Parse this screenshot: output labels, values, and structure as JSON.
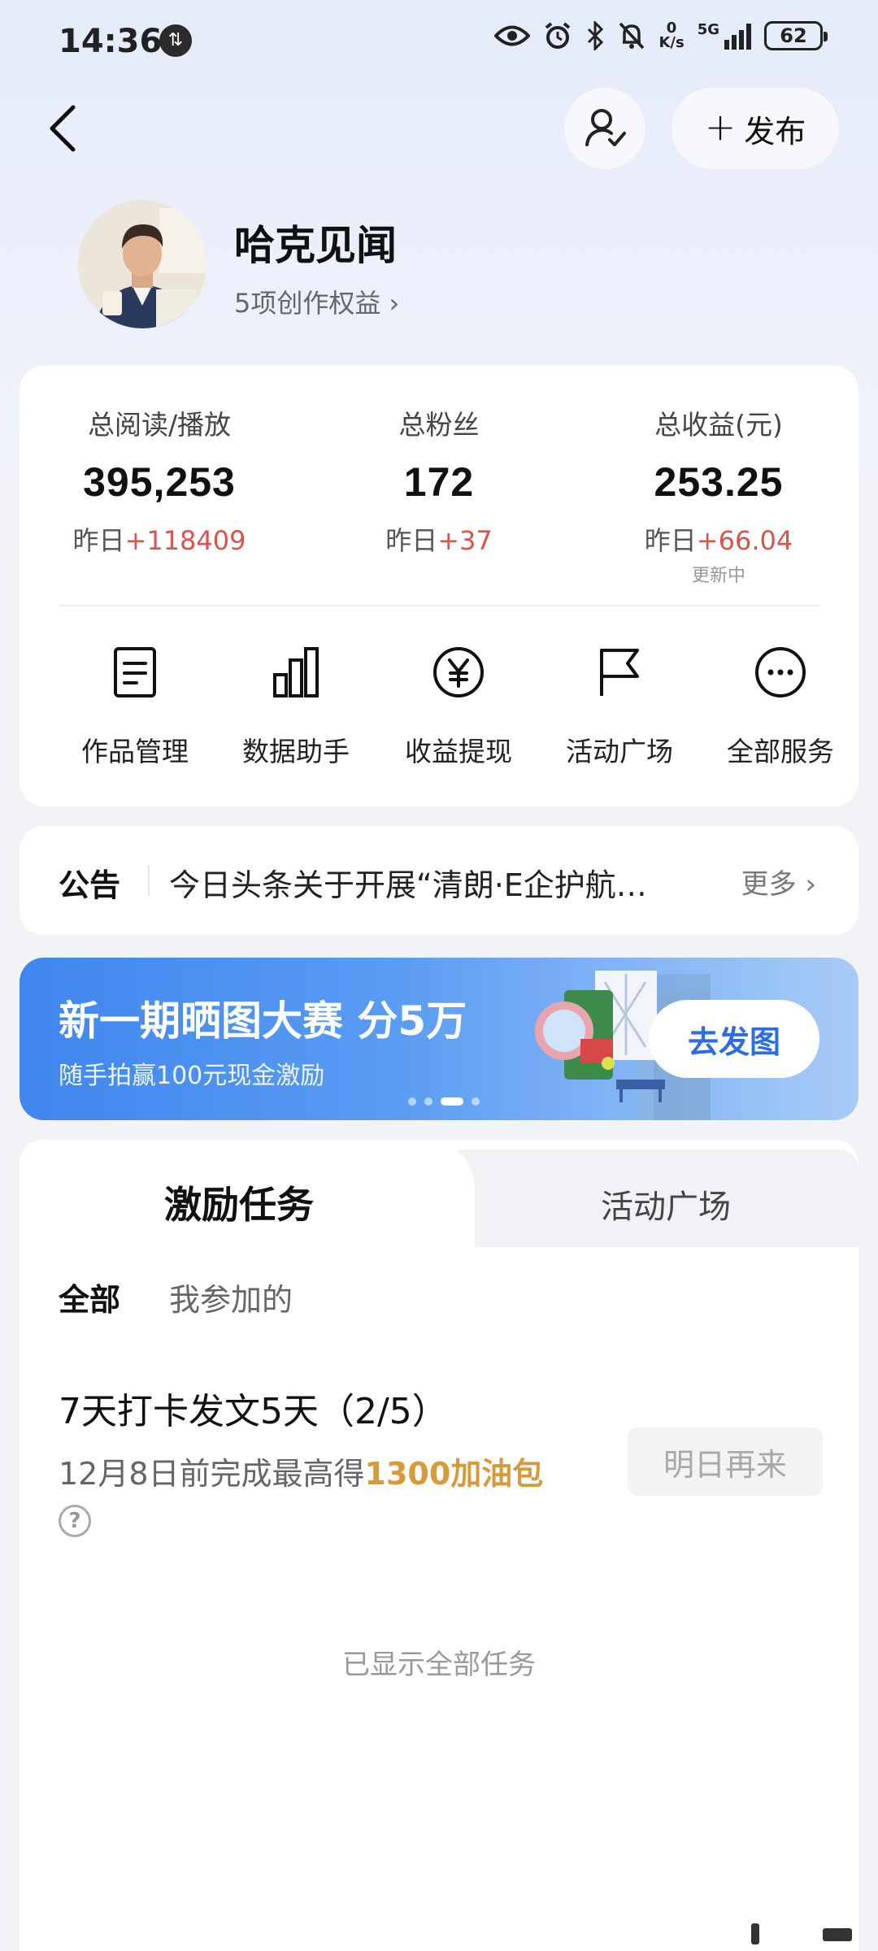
{
  "status_bar": {
    "time": "14:36",
    "net_speed_value": "0",
    "net_speed_unit": "K/s",
    "network": "5G",
    "battery": "62"
  },
  "header": {
    "publish_label": "发布"
  },
  "profile": {
    "name": "哈克见闻",
    "perks": "5项创作权益 ›"
  },
  "stats": [
    {
      "label": "总阅读/播放",
      "value": "395,253",
      "delta_prefix": "昨日",
      "delta": "+118409",
      "note": ""
    },
    {
      "label": "总粉丝",
      "value": "172",
      "delta_prefix": "昨日",
      "delta": "+37",
      "note": ""
    },
    {
      "label": "总收益(元)",
      "value": "253.25",
      "delta_prefix": "昨日",
      "delta": "+66.04",
      "note": "更新中"
    }
  ],
  "tools": [
    {
      "label": "作品管理",
      "icon": "document-icon"
    },
    {
      "label": "数据助手",
      "icon": "bar-chart-icon"
    },
    {
      "label": "收益提现",
      "icon": "yen-icon"
    },
    {
      "label": "活动广场",
      "icon": "flag-icon"
    },
    {
      "label": "全部服务",
      "icon": "more-icon"
    }
  ],
  "notice": {
    "tag": "公告",
    "text": "今日头条关于开展“清朗·E企护航…",
    "more": "更多 ›"
  },
  "banner": {
    "title": "新一期晒图大赛 分5万",
    "subtitle": "随手拍赢100元现金激励",
    "cta": "去发图",
    "page_count": 4,
    "active_page": 3
  },
  "tasks": {
    "tab_active": "激励任务",
    "tab_inactive": "活动广场",
    "filter_all": "全部",
    "filter_mine": "我参加的",
    "items": [
      {
        "name": "7天打卡发文5天（2/5）",
        "desc_prefix": "12月8日前完成最高得",
        "reward": "1300加油包",
        "button": "明日再来"
      }
    ],
    "footer": "已显示全部任务"
  },
  "colors": {
    "delta_red": "#d9534f",
    "reward_gold": "#d69a3a",
    "banner_blue": "#3f86ee",
    "cta_text": "#2e6de0"
  }
}
